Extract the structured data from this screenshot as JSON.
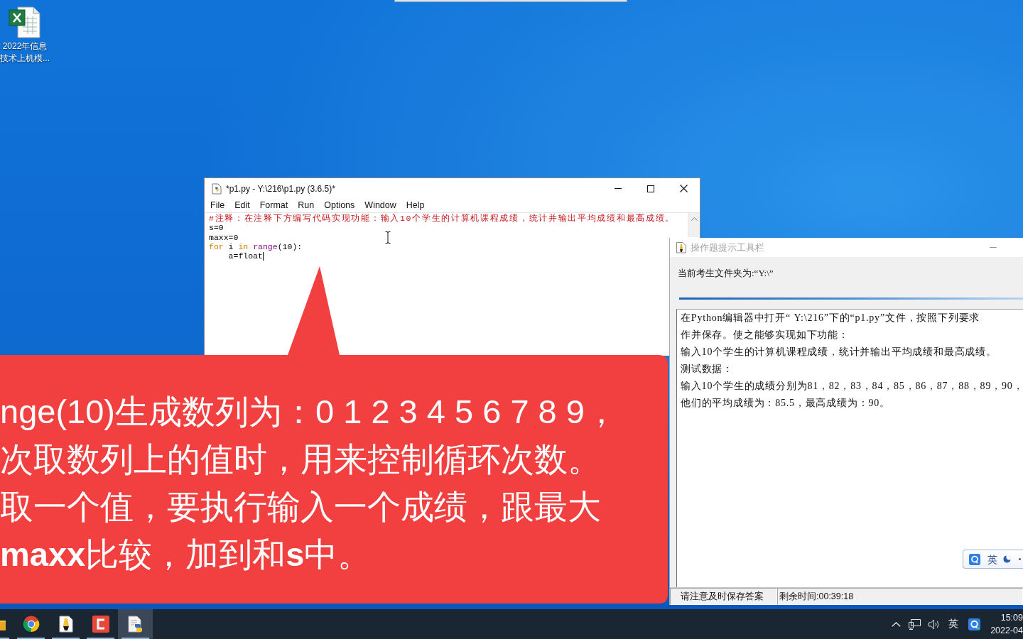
{
  "desktop_icons": [
    {
      "label_lines": [
        "2022年信息",
        "技术上机模..."
      ]
    }
  ],
  "editor_window": {
    "title": "*p1.py - Y:\\216\\p1.py (3.6.5)*",
    "active": true,
    "menu": [
      "File",
      "Edit",
      "Format",
      "Run",
      "Options",
      "Window",
      "Help"
    ],
    "code_lines": [
      {
        "caret": false,
        "tokens": [
          {
            "kind": "comment",
            "text": "#注释：在注释下方编写代码实现功能：输入10个学生的计算机课程成绩，统计并输出平均成绩和最高成绩。"
          }
        ]
      },
      {
        "caret": false,
        "tokens": [
          {
            "kind": "plain",
            "text": "s=0"
          }
        ]
      },
      {
        "caret": false,
        "tokens": [
          {
            "kind": "plain",
            "text": "maxx=0"
          }
        ]
      },
      {
        "caret": false,
        "tokens": [
          {
            "kind": "keyword",
            "text": "for"
          },
          {
            "kind": "plain",
            "text": " i "
          },
          {
            "kind": "keyword",
            "text": "in"
          },
          {
            "kind": "builtin",
            "text": " range"
          },
          {
            "kind": "plain",
            "text": "(10):"
          }
        ]
      },
      {
        "caret": true,
        "tokens": [
          {
            "kind": "plain",
            "text": "    a=float"
          }
        ]
      }
    ]
  },
  "hint_window": {
    "title": "操作题提示工具栏",
    "active": false,
    "folder_label": "当前考生文件夹为:“Y:\\”",
    "instructions": [
      "在Python编辑器中打开“ Y:\\216”下的“p1.py”文件，按照下列要求",
      "作并保存。使之能够实现如下功能：",
      "输入10个学生的计算机课程成绩，统计并输出平均成绩和最高成绩。",
      "测试数据：",
      "输入10个学生的成绩分别为81，82，83，84，85，86，87，88，89，90，",
      "他们的平均成绩为：85.5，最高成绩为：90。"
    ],
    "status": [
      "请注意及时保存答案",
      "剩余时间:00:39:18"
    ]
  },
  "ime_bar": {
    "mode": "英"
  },
  "callout": {
    "lines": [
      "nge(10)生成数列为：0 1 2 3 4 5 6 7 8 9，",
      "次取数列上的值时，用来控制循环次数。",
      "取一个值，要执行输入一个成绩，跟最大",
      "**maxx**比较，加到和**s**中。"
    ]
  },
  "taskbar": {
    "apps": [
      {
        "kind": "folder",
        "selected": false,
        "running": true
      },
      {
        "kind": "browser",
        "selected": false,
        "running": true
      },
      {
        "kind": "pen",
        "selected": false,
        "running": true
      },
      {
        "kind": "recorder",
        "selected": false,
        "running": true
      },
      {
        "kind": "script",
        "selected": true,
        "running": true
      }
    ],
    "tray_ime": "英",
    "clock": {
      "time": "15:09",
      "date": "2022-04"
    }
  }
}
